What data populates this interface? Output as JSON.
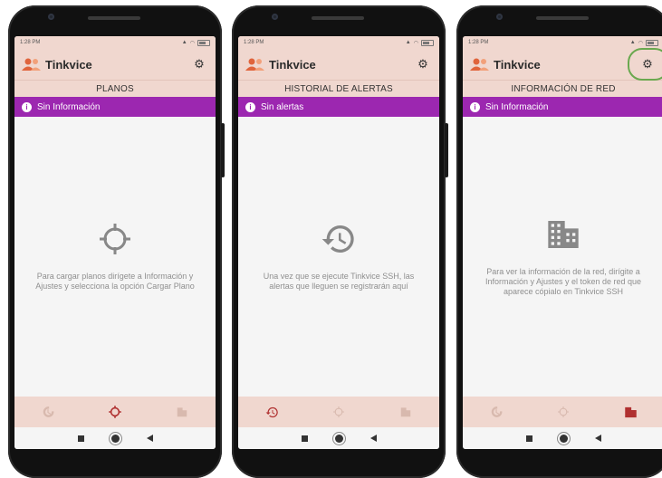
{
  "app": {
    "title": "Tinkvice"
  },
  "colors": {
    "accent": "#9c27b0",
    "appbar": "#f0d7cf",
    "active_nav": "#b03030",
    "inactive_nav": "#d8b9ae",
    "highlight_ring": "#6aa84f"
  },
  "phones": [
    {
      "status": {
        "time": "1:28 PM"
      },
      "section_title": "PLANOS",
      "alert": "Sin Información",
      "icon": "crosshair-icon",
      "message": "Para cargar planos dirígete a Información y Ajustes y selecciona la opción Cargar Plano",
      "active_tab": "planos"
    },
    {
      "status": {
        "time": "1:28 PM"
      },
      "section_title": "HISTORIAL DE ALERTAS",
      "alert": "Sin alertas",
      "icon": "history-icon",
      "message": "Una vez que se ejecute Tinkvice SSH, las alertas que lleguen se registrarán aquí",
      "active_tab": "historial"
    },
    {
      "status": {
        "time": "1:28 PM"
      },
      "section_title": "INFORMACIÓN DE RED",
      "alert": "Sin Información",
      "icon": "building-icon",
      "message": "Para ver la información de la red, dirígite a Información y Ajustes y el token de red que aparece cópialo en Tinkvice SSH",
      "active_tab": "red"
    }
  ]
}
